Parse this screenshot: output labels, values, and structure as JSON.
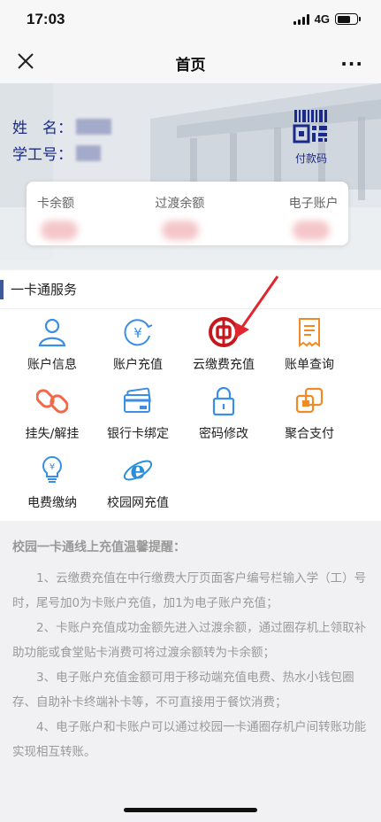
{
  "status": {
    "time": "17:03",
    "network": "4G"
  },
  "nav": {
    "title": "首页"
  },
  "user": {
    "name_label": "姓　名：",
    "id_label": "学工号：",
    "paycode_label": "付款码"
  },
  "balances": {
    "card_label": "卡余额",
    "transit_label": "过渡余额",
    "ewallet_label": "电子账户"
  },
  "section": {
    "title": "一卡通服务"
  },
  "services": [
    {
      "label": "账户信息",
      "icon": "person-icon"
    },
    {
      "label": "账户充值",
      "icon": "yuan-icon"
    },
    {
      "label": "云缴费充值",
      "icon": "boc-icon"
    },
    {
      "label": "账单查询",
      "icon": "bill-icon"
    },
    {
      "label": "挂失/解挂",
      "icon": "link-icon"
    },
    {
      "label": "银行卡绑定",
      "icon": "bank-card-icon"
    },
    {
      "label": "密码修改",
      "icon": "lock-icon"
    },
    {
      "label": "聚合支付",
      "icon": "aggregate-icon"
    },
    {
      "label": "电费缴纳",
      "icon": "bulb-icon"
    },
    {
      "label": "校园网充值",
      "icon": "ie-icon"
    }
  ],
  "notice": {
    "title": "校园一卡通线上充值温馨提醒：",
    "items": [
      "1、云缴费充值在中行缴费大厅页面客户编号栏输入学（工）号时，尾号加0为卡账户充值，加1为电子账户充值；",
      "2、卡账户充值成功金额先进入过渡余额，通过圈存机上领取补助功能或食堂贴卡消费可将过渡余额转为卡余额；",
      "3、电子账户充值金额可用于移动端充值电费、热水小钱包圈存、自助补卡终端补卡等，不可直接用于餐饮消费；",
      "4、电子账户和卡账户可以通过校园一卡通圈存机户间转账功能实现相互转账。"
    ]
  },
  "colors": {
    "accent": "#1a2a8a",
    "orange": "#f08a24",
    "blue": "#3a8ee6",
    "red": "#c8161d"
  }
}
